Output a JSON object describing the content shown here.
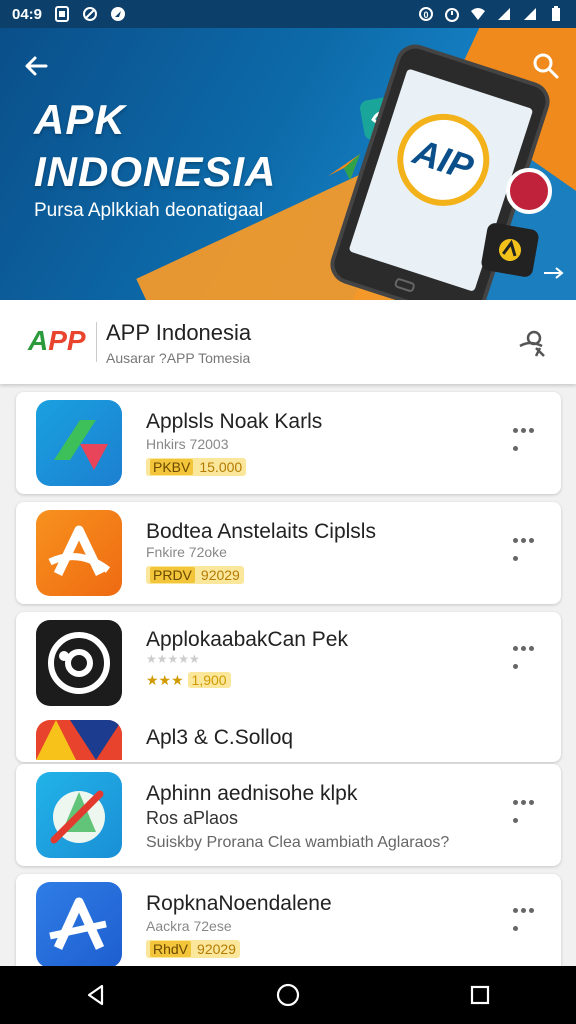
{
  "status_bar": {
    "time": "04:9",
    "notification_icons": [
      "sim-icon",
      "blocked-icon",
      "location-icon"
    ],
    "system_icons": [
      "alarm-icon",
      "clock-icon",
      "wifi-icon",
      "signal-icon",
      "signal-icon-2",
      "battery-icon"
    ]
  },
  "hero": {
    "title_line1": "APK",
    "title_line2": "INDONESIA",
    "subtitle": "Pursa Aplkkiah deonatigaal",
    "phone_logo": "AIP",
    "colors": {
      "blue": "#0d6aa9",
      "orange": "#f08a1c"
    }
  },
  "app_header": {
    "logo_text_green": "A",
    "logo_text_red": "PP",
    "name": "APP Indonesia",
    "subtitle": "Ausarar ?APP Tomesia"
  },
  "list": [
    {
      "title": "Applsls Noak Karls",
      "meta": "Hnkirs 72003",
      "tag": "PKBV",
      "price": "15.000",
      "icon": "blue-green-triangle-icon"
    },
    {
      "title": "Bodtea Anstelaits Ciplsls",
      "meta": "Fnkire 72oke",
      "tag": "PRDV",
      "price": "92029",
      "icon": "orange-a-icon"
    },
    {
      "title": "ApplokaabakCan Pek",
      "meta": "★★★★★",
      "stars": "★★★",
      "price": "1,900",
      "icon": "black-disc-icon"
    },
    {
      "title": "Apl3 & C.Solloq",
      "icon": "red-yellow-icon"
    },
    {
      "title": "Aphinn aednisohe klpk",
      "subtitle": "Ros aPlaos",
      "meta": "Suiskby Prorana Clea wambiath Aglaraos?",
      "icon": "pen-compass-icon"
    },
    {
      "title": "RopknaNoendalene",
      "meta": "Aackra 72ese",
      "tag": "RhdV",
      "price": "92029",
      "icon": "blue-a-icon"
    }
  ]
}
